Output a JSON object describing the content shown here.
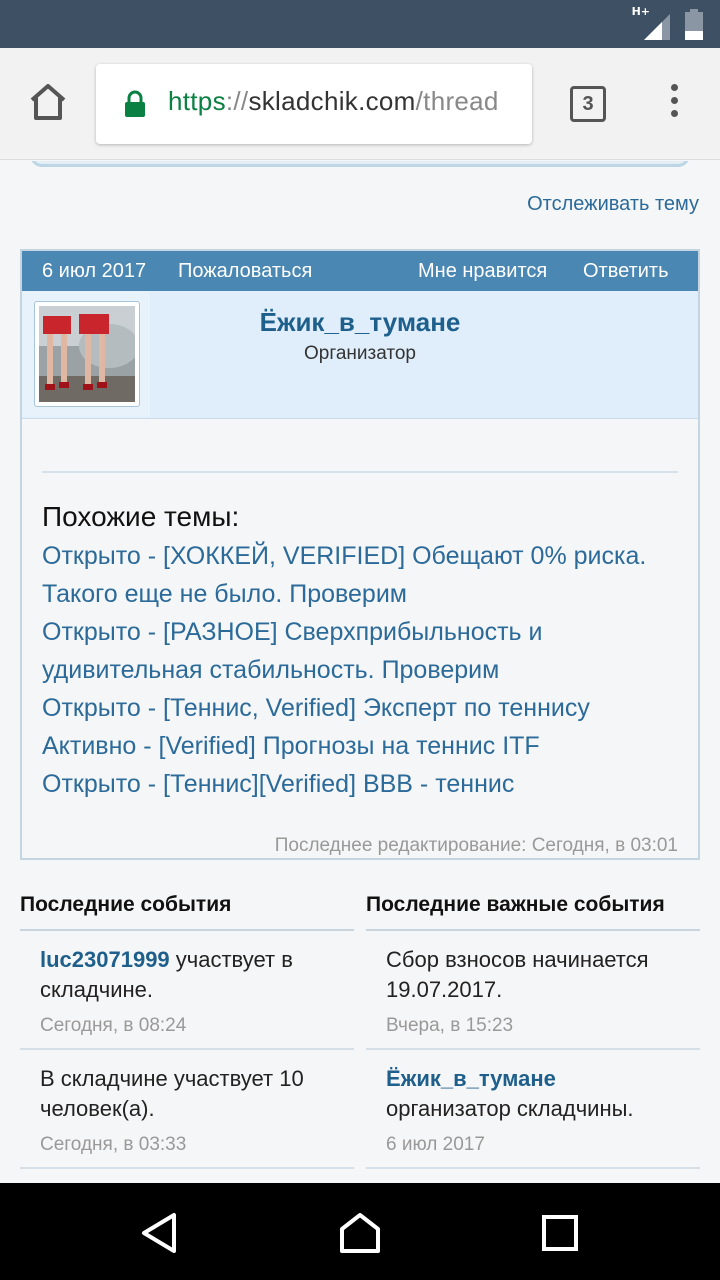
{
  "statusbar": {
    "network": "H+"
  },
  "browser": {
    "url_protocol": "https",
    "url_separator": "://",
    "url_domain": "skladchik.com",
    "url_path": "/thread",
    "tab_count": "3"
  },
  "page": {
    "watch_thread": "Отслеживать тему",
    "post": {
      "date": "6 июл 2017",
      "report": "Пожаловаться",
      "like": "Мне нравится",
      "reply": "Ответить",
      "username": "Ёжик_в_тумане",
      "user_title": "Организатор",
      "similar_heading": "Похожие темы:",
      "similar_threads": [
        "Открыто - [ХОККЕЙ, VERIFIED] Обещают 0% риска. Такого еще не было. Проверим",
        "Открыто - [РАЗНОЕ] Сверхприбыльность и удивительная стабильность. Проверим",
        "Открыто - [Теннис, Verified] Эксперт по теннису",
        "Активно - [Verified] Прогнозы на теннис ITF",
        "Открыто - [Теннис][Verified] ВВВ - теннис"
      ],
      "last_edit": "Последнее редактирование: Сегодня, в 03:01"
    },
    "recent_events": {
      "heading": "Последние события",
      "items": [
        {
          "user": "luc23071999",
          "text": " участвует в складчине.",
          "time": "Сегодня, в 08:24"
        },
        {
          "user": "",
          "text": "В складчине участвует 10 человек(а).",
          "time": "Сегодня, в 03:33"
        }
      ]
    },
    "important_events": {
      "heading": "Последние важные события",
      "items": [
        {
          "user": "",
          "text": "Сбор взносов начинается 19.07.2017.",
          "time": "Вчера, в 15:23"
        },
        {
          "user": "Ёжик_в_тумане",
          "text": "организатор складчины.",
          "time": "6 июл 2017"
        }
      ]
    }
  },
  "colors": {
    "status_bar": "#3e5063",
    "post_bar": "#4a87b3",
    "link": "#2b6a99",
    "url_secure": "#0b8043"
  },
  "icons": {
    "home": "home-icon",
    "lock": "lock-icon",
    "tabs": "tabs-icon",
    "menu": "more-vert-icon",
    "back": "back-triangle-icon",
    "home_nav": "home-pentagon-icon",
    "recents": "recents-square-icon"
  }
}
